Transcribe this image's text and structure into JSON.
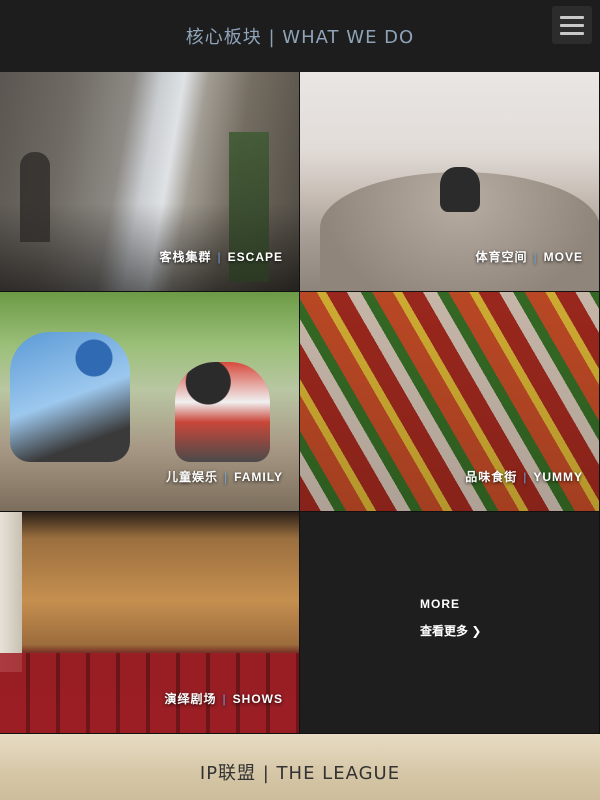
{
  "header": {
    "title": "核心板块 | WHAT WE DO",
    "menu_icon": "hamburger-menu-icon"
  },
  "tiles": [
    {
      "cn": "客栈集群",
      "en": "ESCAPE"
    },
    {
      "cn": "体育空间",
      "en": "MOVE"
    },
    {
      "cn": "儿童娱乐",
      "en": "FAMILY"
    },
    {
      "cn": "品味食街",
      "en": "YUMMY"
    },
    {
      "cn": "演绎剧场",
      "en": "SHOWS"
    }
  ],
  "more": {
    "title": "MORE",
    "link": "查看更多",
    "link_icon": "chevron-right-icon"
  },
  "footer": {
    "title": "IP联盟 | THE LEAGUE"
  },
  "colors": {
    "header_bg": "#1d1d1d",
    "title_color": "#8fa3b8",
    "separator_accent": "#6fa5d8",
    "footer_bg": "#d8c9ad"
  }
}
